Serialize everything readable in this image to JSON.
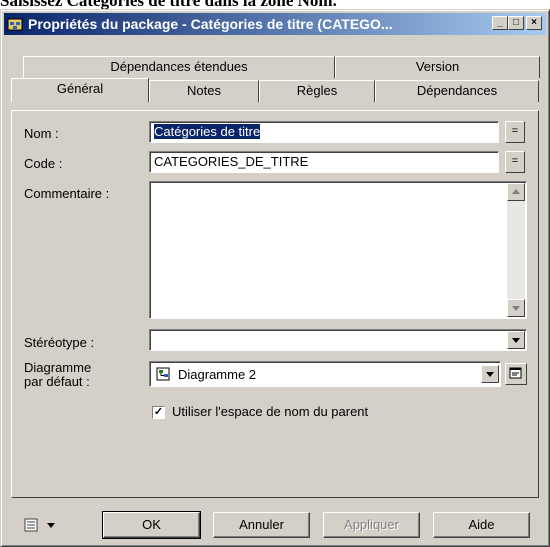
{
  "caption": "Saisissez Catégories de titre dans la zone Nom.",
  "window": {
    "title": "Propriétés du package - Catégories de titre (CATEGO...",
    "controls": {
      "minimize": "_",
      "maximize": "□",
      "close": "×"
    }
  },
  "tabs": {
    "back_row": [
      "Dépendances étendues",
      "Version"
    ],
    "front_row": [
      "Général",
      "Notes",
      "Règles",
      "Dépendances"
    ],
    "active": "Général"
  },
  "form": {
    "nom_label": "Nom :",
    "nom_value": "Catégories de titre",
    "code_label": "Code :",
    "code_value": "CATEGORIES_DE_TITRE",
    "commentaire_label": "Commentaire :",
    "commentaire_value": "",
    "stereotype_label": "Stéréotype :",
    "stereotype_value": "",
    "diagramme_label_line1": "Diagramme",
    "diagramme_label_line2": "par défaut :",
    "diagramme_value": "Diagramme 2",
    "checkbox_label": "Utiliser l'espace de nom du parent",
    "checkbox_checked": true,
    "equals_glyph": "="
  },
  "footer": {
    "ok": "OK",
    "annuler": "Annuler",
    "appliquer": "Appliquer",
    "aide": "Aide"
  },
  "icons": {
    "title": "package-properties-icon",
    "diagram": "diagram-icon",
    "properties": "properties-icon",
    "menu": "list-menu-icon"
  }
}
